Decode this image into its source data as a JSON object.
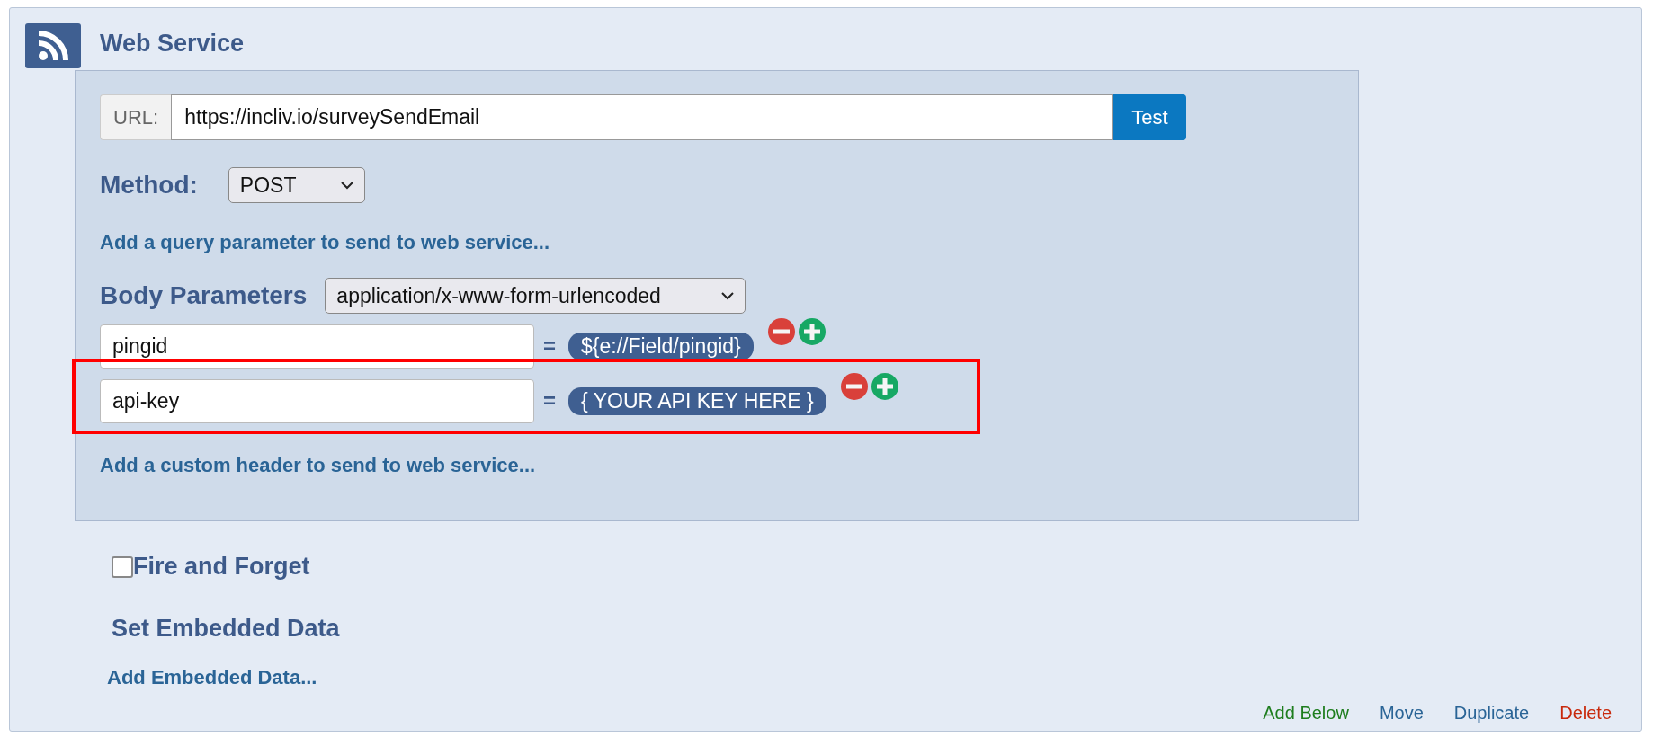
{
  "title": "Web Service",
  "url": {
    "label": "URL:",
    "value": "https://incliv.io/surveySendEmail",
    "button": "Test"
  },
  "method": {
    "label": "Method:",
    "value": "POST"
  },
  "query_link": "Add a query parameter to send to web service...",
  "body": {
    "label": "Body Parameters",
    "encoding": "application/x-www-form-urlencoded",
    "rows": [
      {
        "key": "pingid",
        "equals": "=",
        "value": "${e://Field/pingid}",
        "highlighted": false
      },
      {
        "key": "api-key",
        "equals": "=",
        "value": "{ YOUR API KEY HERE }",
        "highlighted": true
      }
    ]
  },
  "header_link": "Add a custom header to send to web service...",
  "fire_and_forget": {
    "label": "Fire and Forget",
    "checked": false
  },
  "embedded": {
    "heading": "Set Embedded Data",
    "link": "Add Embedded Data..."
  },
  "actions": [
    {
      "label": "Add Below",
      "color": "#1e7d1e"
    },
    {
      "label": "Move",
      "color": "#2a6496"
    },
    {
      "label": "Duplicate",
      "color": "#2a6496"
    },
    {
      "label": "Delete",
      "color": "#c8290c"
    }
  ]
}
